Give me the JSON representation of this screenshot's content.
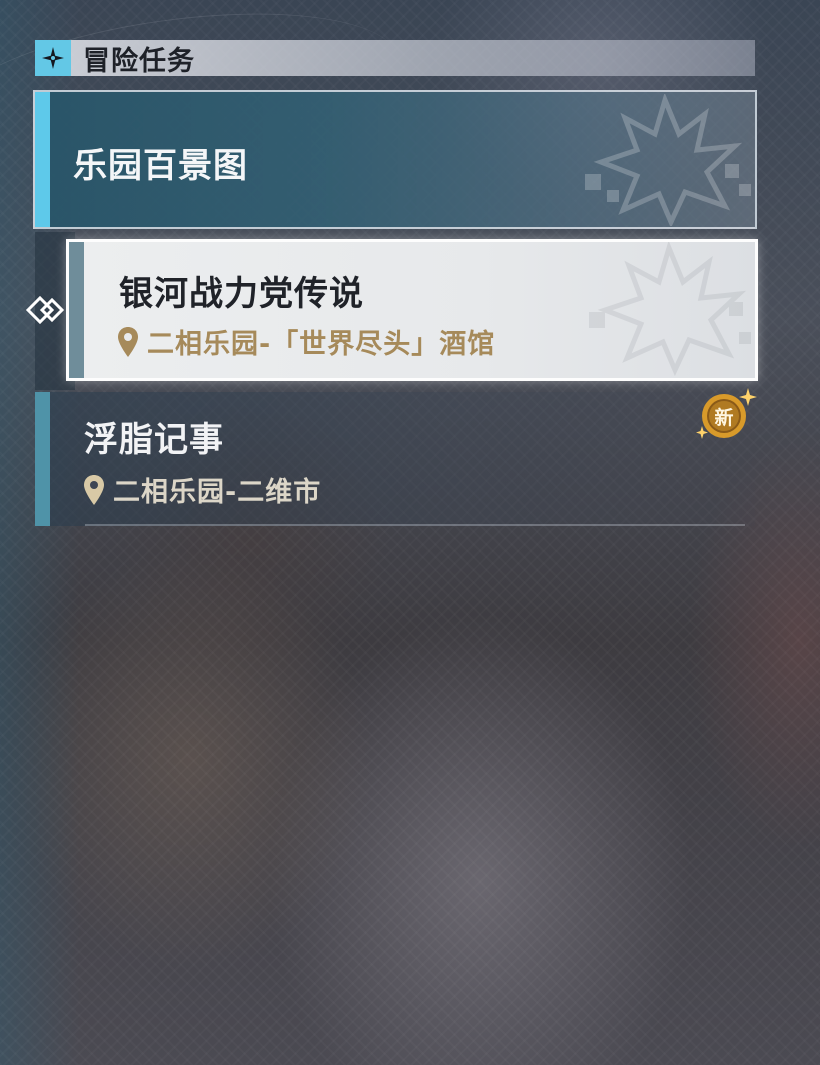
{
  "header": {
    "title": "冒险任务",
    "icon": "four-point-star-icon",
    "accent_color": "#63c8e6"
  },
  "quests": [
    {
      "title": "乐园百景图",
      "state": "category",
      "bar_color": "#5ec9ea"
    },
    {
      "title": "银河战力党传说",
      "location": "二相乐园-「世界尽头」酒馆",
      "state": "selected",
      "bar_color": "#6f8d9a",
      "location_color": "#a68a5a"
    },
    {
      "title": "浮脂记事",
      "location": "二相乐园-二维市",
      "state": "normal",
      "badge": "新",
      "bar_color": "#4f93a8"
    }
  ],
  "icons": {
    "selection": "selection-arrow-icon",
    "location": "location-pin-icon",
    "badge_color": "#d89a2a"
  }
}
